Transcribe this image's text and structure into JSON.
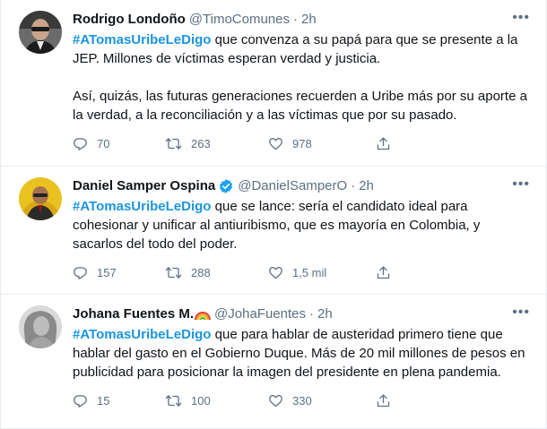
{
  "colors": {
    "hashtag": "#1b95e0",
    "muted": "#5b7083",
    "text": "#0f1419",
    "divider": "#e6ecf0",
    "verified": "#1da1f2"
  },
  "tweets": [
    {
      "name": "Rodrigo Londoño",
      "handle": "@TimoComunes",
      "separator": "·",
      "time": "2h",
      "verified": false,
      "hashtag": "#ATomasUribeLeDigo",
      "body": " que convenza a su papá para que se presente a la JEP. Millones de víctimas esperan verdad y justicia.\n\nAsí, quizás, las futuras generaciones recuerden a Uribe más por su aporte a la verdad, a la reconciliación y a las víctimas que por su pasado.",
      "replies": "70",
      "retweets": "263",
      "likes": "978",
      "more_icon": "more-icon"
    },
    {
      "name": "Daniel Samper Ospina",
      "handle": "@DanielSamperO",
      "separator": "·",
      "time": "2h",
      "verified": true,
      "hashtag": "#ATomasUribeLeDigo",
      "body": " que se lance: sería el candidato ideal para cohesionar y unificar al antiuribismo, que es mayoría en Colombia, y sacarlos del todo del poder.",
      "replies": "157",
      "retweets": "288",
      "likes": "1,5 mil",
      "more_icon": "more-icon"
    },
    {
      "name": "Johana Fuentes M.",
      "handle": "@JohaFuentes",
      "separator": "·",
      "time": "2h",
      "verified": false,
      "hashtag": "#ATomasUribeLeDigo",
      "body": " que para hablar de austeridad primero tiene que hablar del gasto en el Gobierno Duque. Más de 20 mil millones de pesos en publicidad para posicionar la imagen del presidente en plena pandemia.",
      "replies": "15",
      "retweets": "100",
      "likes": "330",
      "more_icon": "more-icon"
    }
  ]
}
